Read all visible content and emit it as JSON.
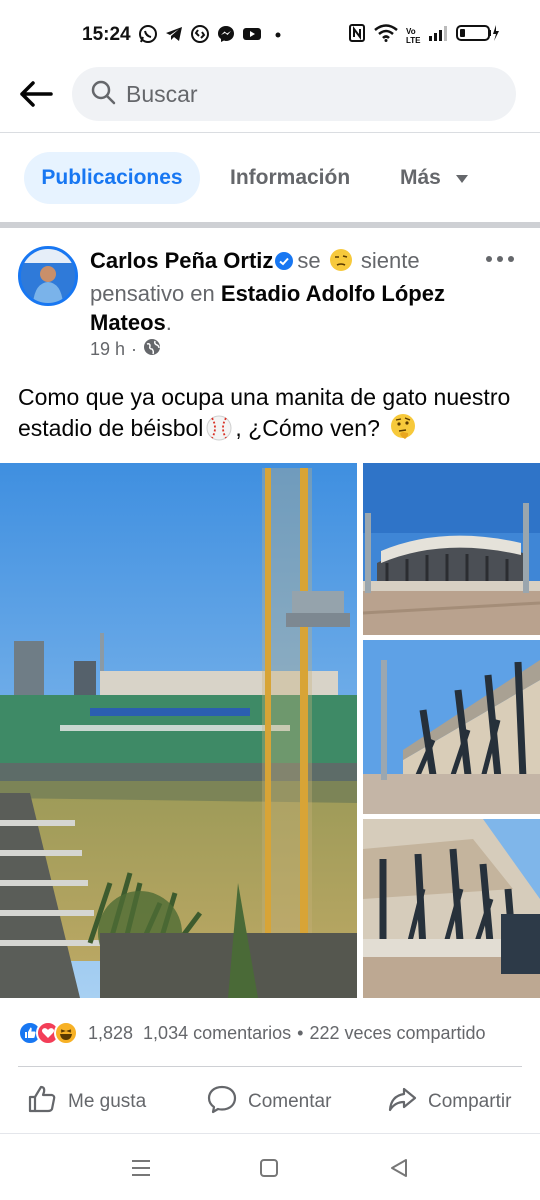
{
  "status_bar": {
    "time": "15:24",
    "app_icons": [
      "whatsapp-icon",
      "telegram-icon",
      "shazam-icon",
      "messenger-icon",
      "youtube-icon",
      "more-dot-icon"
    ],
    "system_icons": [
      "nfc-icon",
      "wifi-icon",
      "volte-icon",
      "signal-icon",
      "battery-charging-icon"
    ],
    "volte_text": "Vo LTE"
  },
  "search": {
    "placeholder": "Buscar"
  },
  "tabs": [
    {
      "label": "Publicaciones",
      "active": true
    },
    {
      "label": "Información",
      "active": false
    },
    {
      "label": "Más",
      "active": false
    }
  ],
  "post": {
    "author": "Carlos Peña Ortiz",
    "verified": true,
    "feeling_prefix": "se",
    "feeling": "siente pensativo en",
    "location": "Estadio Adolfo López Mateos",
    "location_suffix": ".",
    "time": "19 h",
    "time_sep": "·",
    "visibility": "public-globe-icon",
    "text_before": "Como que ya ocupa una manita de gato nuestro estadio de béisbol",
    "text_after": ", ¿Cómo ven?",
    "photo_count": 4
  },
  "reactions": {
    "types": [
      "like",
      "love",
      "haha"
    ],
    "count": "1,828",
    "comments": "1,034 comentarios",
    "separator": "•",
    "shares": "222 veces compartido"
  },
  "actions": {
    "like": "Me gusta",
    "comment": "Comentar",
    "share": "Compartir"
  },
  "colors": {
    "accent": "#1877f2",
    "tab_active_bg": "#e7f3ff",
    "muted": "#65676b",
    "love": "#f33e58",
    "haha": "#f7b125"
  }
}
